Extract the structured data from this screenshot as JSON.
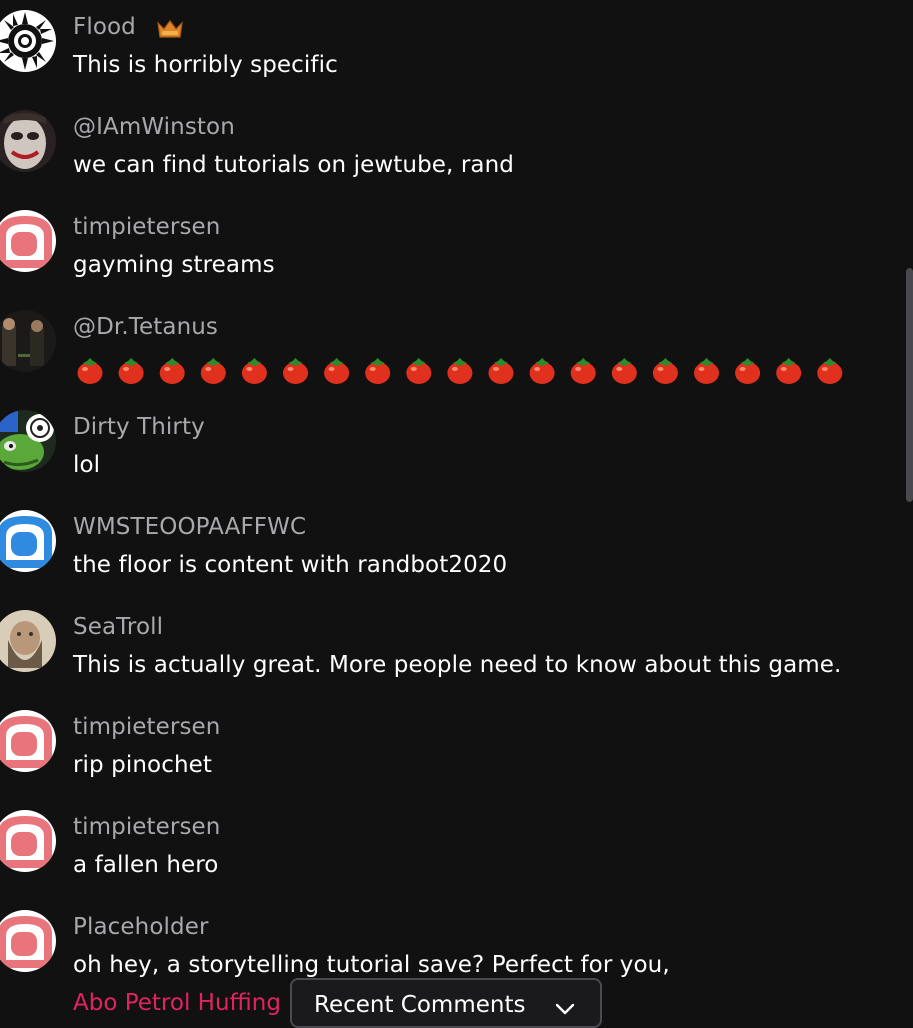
{
  "messages": [
    {
      "username": "Flood",
      "text": "This is horribly specific",
      "badge": "crown-badge",
      "avatar": "sun-burst"
    },
    {
      "username": "@IAmWinston",
      "text": "we can find tutorials on jewtube, rand",
      "avatar": "joker-face"
    },
    {
      "username": "timpietersen",
      "text": "gayming streams",
      "avatar": "default-pink"
    },
    {
      "username": "@Dr.Tetanus",
      "text": "",
      "emotes": {
        "name": "tomato-emote",
        "glyph": "🍅",
        "count": 19
      },
      "avatar": "movie-still"
    },
    {
      "username": "Dirty Thirty",
      "text": "lol",
      "avatar": "pepe-green"
    },
    {
      "username": "WMSTEOOPAAFFWC",
      "text": "the floor is content with randbot2020",
      "avatar": "default-blue"
    },
    {
      "username": "SeaTroll",
      "text": "This is actually great. More people need to know about this game.",
      "avatar": "bearded-face"
    },
    {
      "username": "timpietersen",
      "text": "rip pinochet",
      "avatar": "default-pink"
    },
    {
      "username": "timpietersen",
      "text": "a fallen hero",
      "avatar": "default-pink"
    },
    {
      "username": "Placeholder",
      "text": "oh hey, a storytelling tutorial save? Perfect for you,",
      "avatar": "default-pink"
    }
  ],
  "extra_line": "Abo Petrol Huffing",
  "recent_comments": {
    "label": "Recent Comments",
    "icon": "chevron-down-icon"
  },
  "colors": {
    "background": "#111112",
    "username": "#a9a9ad",
    "message": "#ffffff",
    "mention": "#e0245e",
    "default_pink": "#e8757c",
    "default_blue": "#2e8be0"
  }
}
